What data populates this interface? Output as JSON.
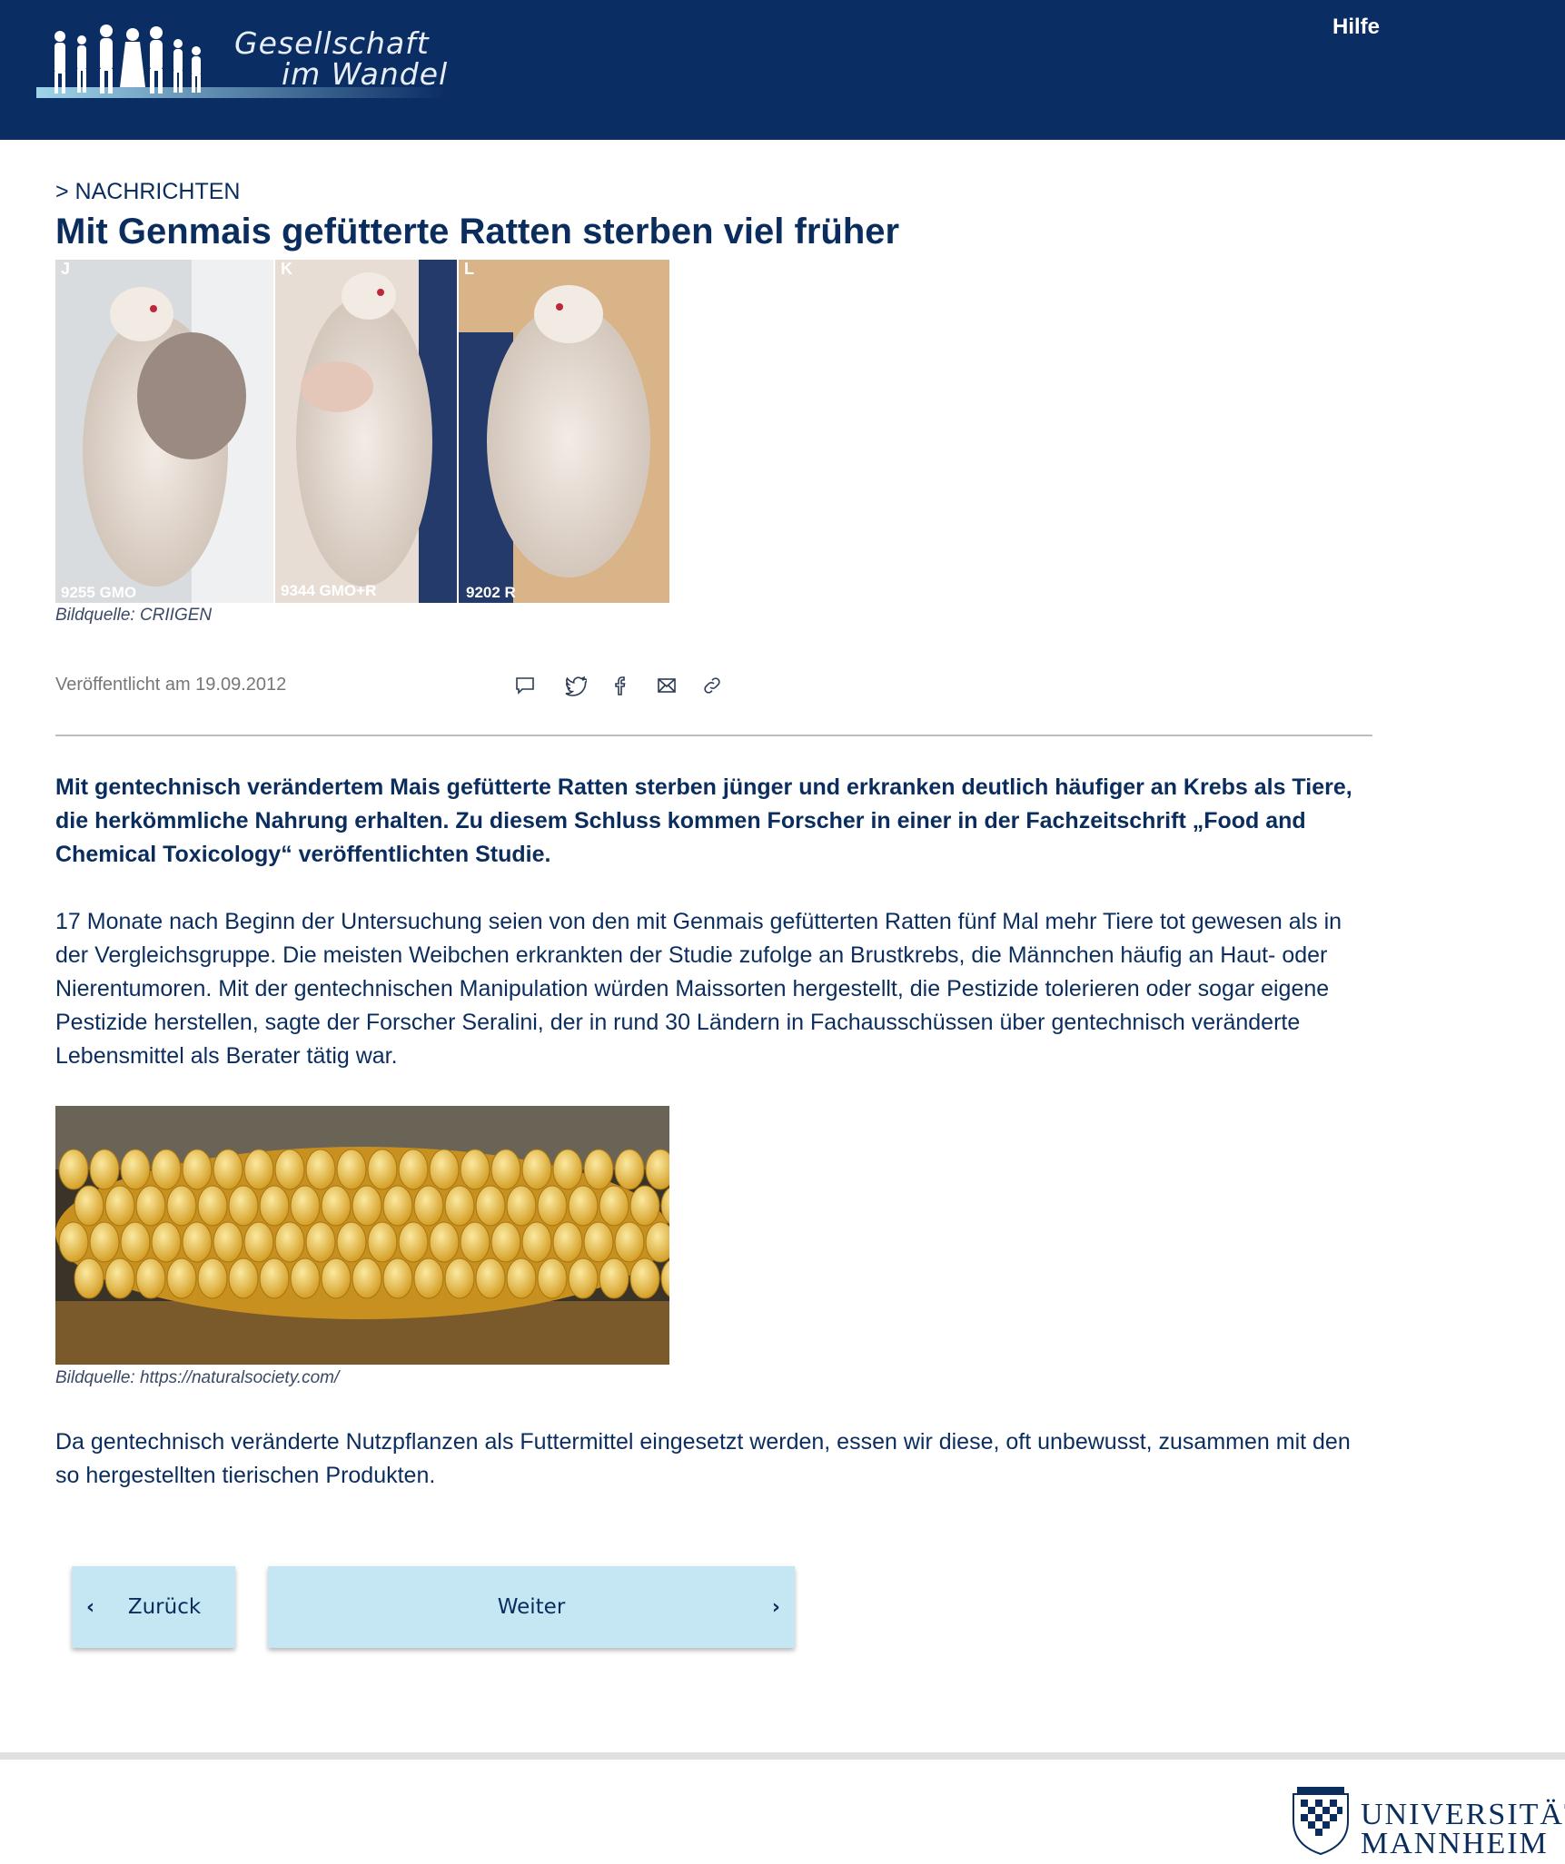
{
  "header": {
    "logo_line1": "Gesellschaft",
    "logo_line2": "im Wandel",
    "help_label": "Hilfe",
    "background": "#0a2d63"
  },
  "article": {
    "breadcrumb": "> NACHRICHTEN",
    "title": "Mit Genmais gefütterte Ratten sterben viel früher",
    "image1": {
      "panel_labels": [
        "J",
        "K",
        "L"
      ],
      "tags": [
        "9255 GMO",
        "9344 GMO+R",
        "9202 R"
      ],
      "caption": "Bildquelle: CRIIGEN"
    },
    "published": "Veröffentlicht am 19.09.2012",
    "share_icons": [
      "comment-icon",
      "twitter-icon",
      "facebook-icon",
      "mail-icon",
      "link-icon"
    ],
    "lead": "Mit gentechnisch verändertem Mais gefütterte Ratten sterben jünger und erkranken deutlich häufiger an Krebs als Tiere, die herkömmliche Nahrung erhalten. Zu diesem Schluss kommen Forscher in einer in der Fachzeitschrift „Food and Chemical Toxicology“ veröffentlichten Studie.",
    "paragraph1": "17 Monate nach Beginn der Untersuchung seien von den mit Genmais gefütterten Ratten fünf Mal mehr Tiere tot gewesen als in der Vergleichsgruppe. Die meisten Weibchen erkrankten der Studie zufolge an Brustkrebs, die Männchen häufig an Haut- oder Nierentumoren. Mit der gentechnischen Manipulation würden Maissorten hergestellt, die Pestizide tolerieren oder sogar eigene Pestizide herstellen, sagte der Forscher Seralini, der in rund 30 Ländern in Fachausschüssen über gentechnisch veränderte Lebensmittel als Berater tätig war.",
    "image2": {
      "caption": "Bildquelle: https://naturalsociety.com/"
    },
    "paragraph2": "Da gentechnisch veränderte Nutzpflanzen als Futtermittel eingesetzt werden, essen wir diese, oft unbewusst, zusammen mit den so hergestellten tierischen Produkten."
  },
  "nav": {
    "back_label": "Zurück",
    "next_label": "Weiter",
    "button_color": "#c5e6f3"
  },
  "footer": {
    "uni_line1": "UNIVERSITÄT",
    "uni_line2": "MANNHEIM"
  }
}
